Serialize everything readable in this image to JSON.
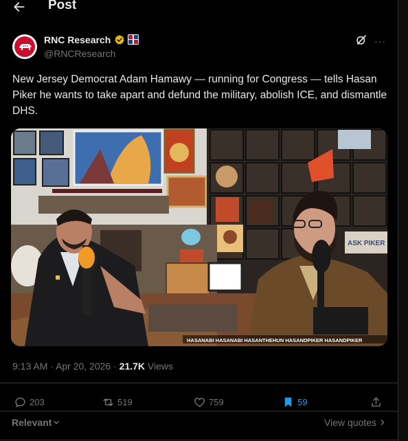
{
  "header": {
    "title": "Post"
  },
  "tweet": {
    "author_name": "RNC Research",
    "author_handle": "@RNCResearch",
    "text": "New Jersey Democrat Adam Hamawy — running for Congress — tells Hasan Piker he wants to take apart and defund the military, abolish ICE, and dismantle DHS.",
    "timestamp": "9:13 AM · Apr 20, 2026 · ",
    "views_count": "21.7K",
    "views_label": " Views",
    "media_watermark": "HASANABI  HASANABI  HASANTHEHUN  HASANDPIKER  HASANDPIKER",
    "media_wall_sign": "ASK PIKER"
  },
  "actions": {
    "replies": "203",
    "reposts": "519",
    "likes": "759",
    "bookmarks": "59"
  },
  "footer": {
    "relevant_label": "Relevant",
    "view_quotes_label": "View quotes"
  },
  "colors": {
    "background": "#000000",
    "text_primary": "#e7e9ea",
    "text_secondary": "#71767b",
    "accent": "#1d9bf0",
    "divider": "#2f3336"
  },
  "icons": [
    "back-arrow-icon",
    "verified-badge-icon",
    "grok-icon",
    "more-icon",
    "reply-icon",
    "repost-icon",
    "like-icon",
    "bookmark-icon",
    "share-icon",
    "chevron-down-icon",
    "chevron-right-icon"
  ]
}
